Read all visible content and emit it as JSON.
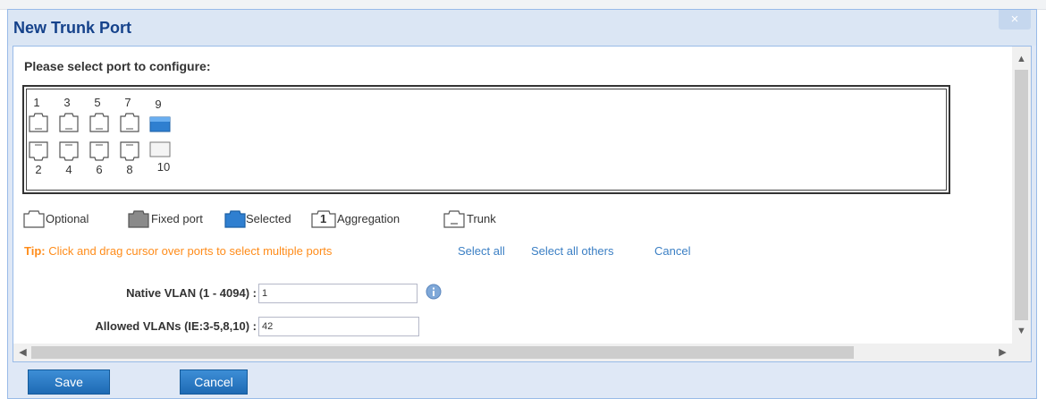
{
  "dialog": {
    "title": "New Trunk Port",
    "close_glyph": "×"
  },
  "ports": {
    "prompt": "Please select port to configure:",
    "top_row": [
      {
        "number": "1",
        "state": "optional"
      },
      {
        "number": "3",
        "state": "optional"
      },
      {
        "number": "5",
        "state": "optional"
      },
      {
        "number": "7",
        "state": "optional"
      },
      {
        "number": "9",
        "state": "selected"
      }
    ],
    "bottom_row": [
      {
        "number": "2",
        "state": "optional"
      },
      {
        "number": "4",
        "state": "optional"
      },
      {
        "number": "6",
        "state": "optional"
      },
      {
        "number": "8",
        "state": "optional"
      },
      {
        "number": "10",
        "state": "optional-sfp"
      }
    ]
  },
  "legend": {
    "optional": "Optional",
    "fixed": "Fixed port",
    "selected": "Selected",
    "aggregation": "Aggregation",
    "aggregation_badge": "1",
    "trunk": "Trunk"
  },
  "tip": {
    "label": "Tip:",
    "text": "Click and drag cursor over ports to select multiple ports",
    "select_all": "Select all",
    "select_all_others": "Select all others",
    "cancel": "Cancel"
  },
  "form": {
    "native_vlan": {
      "label": "Native VLAN (1 - 4094) :",
      "value": "1"
    },
    "allowed_vlans": {
      "label": "Allowed VLANs (IE:3-5,8,10) :",
      "value": "42"
    }
  },
  "footer": {
    "save": "Save",
    "cancel": "Cancel"
  },
  "colors": {
    "title": "#15428b",
    "tip": "#ff8c1a",
    "link": "#3b7fc4",
    "selected_port": "#2f7fd0",
    "button": "#1e6ab4"
  },
  "icons": {
    "scroll_up": "▲",
    "scroll_down": "▼",
    "scroll_left": "◀",
    "scroll_right": "▶",
    "info": "info-icon"
  }
}
